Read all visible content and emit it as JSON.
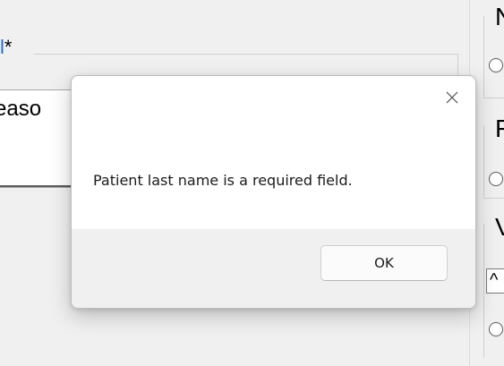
{
  "background_form": {
    "field_label_fragment": "*",
    "field_label_accent_fragment": "l",
    "field_value_fragment": "easo",
    "right_panel": {
      "letters": [
        "N",
        "F",
        "V"
      ],
      "box_glyph": "^"
    }
  },
  "dialog": {
    "message": "Patient last name is a required field.",
    "ok_label": "OK",
    "close_icon": "close-icon"
  }
}
